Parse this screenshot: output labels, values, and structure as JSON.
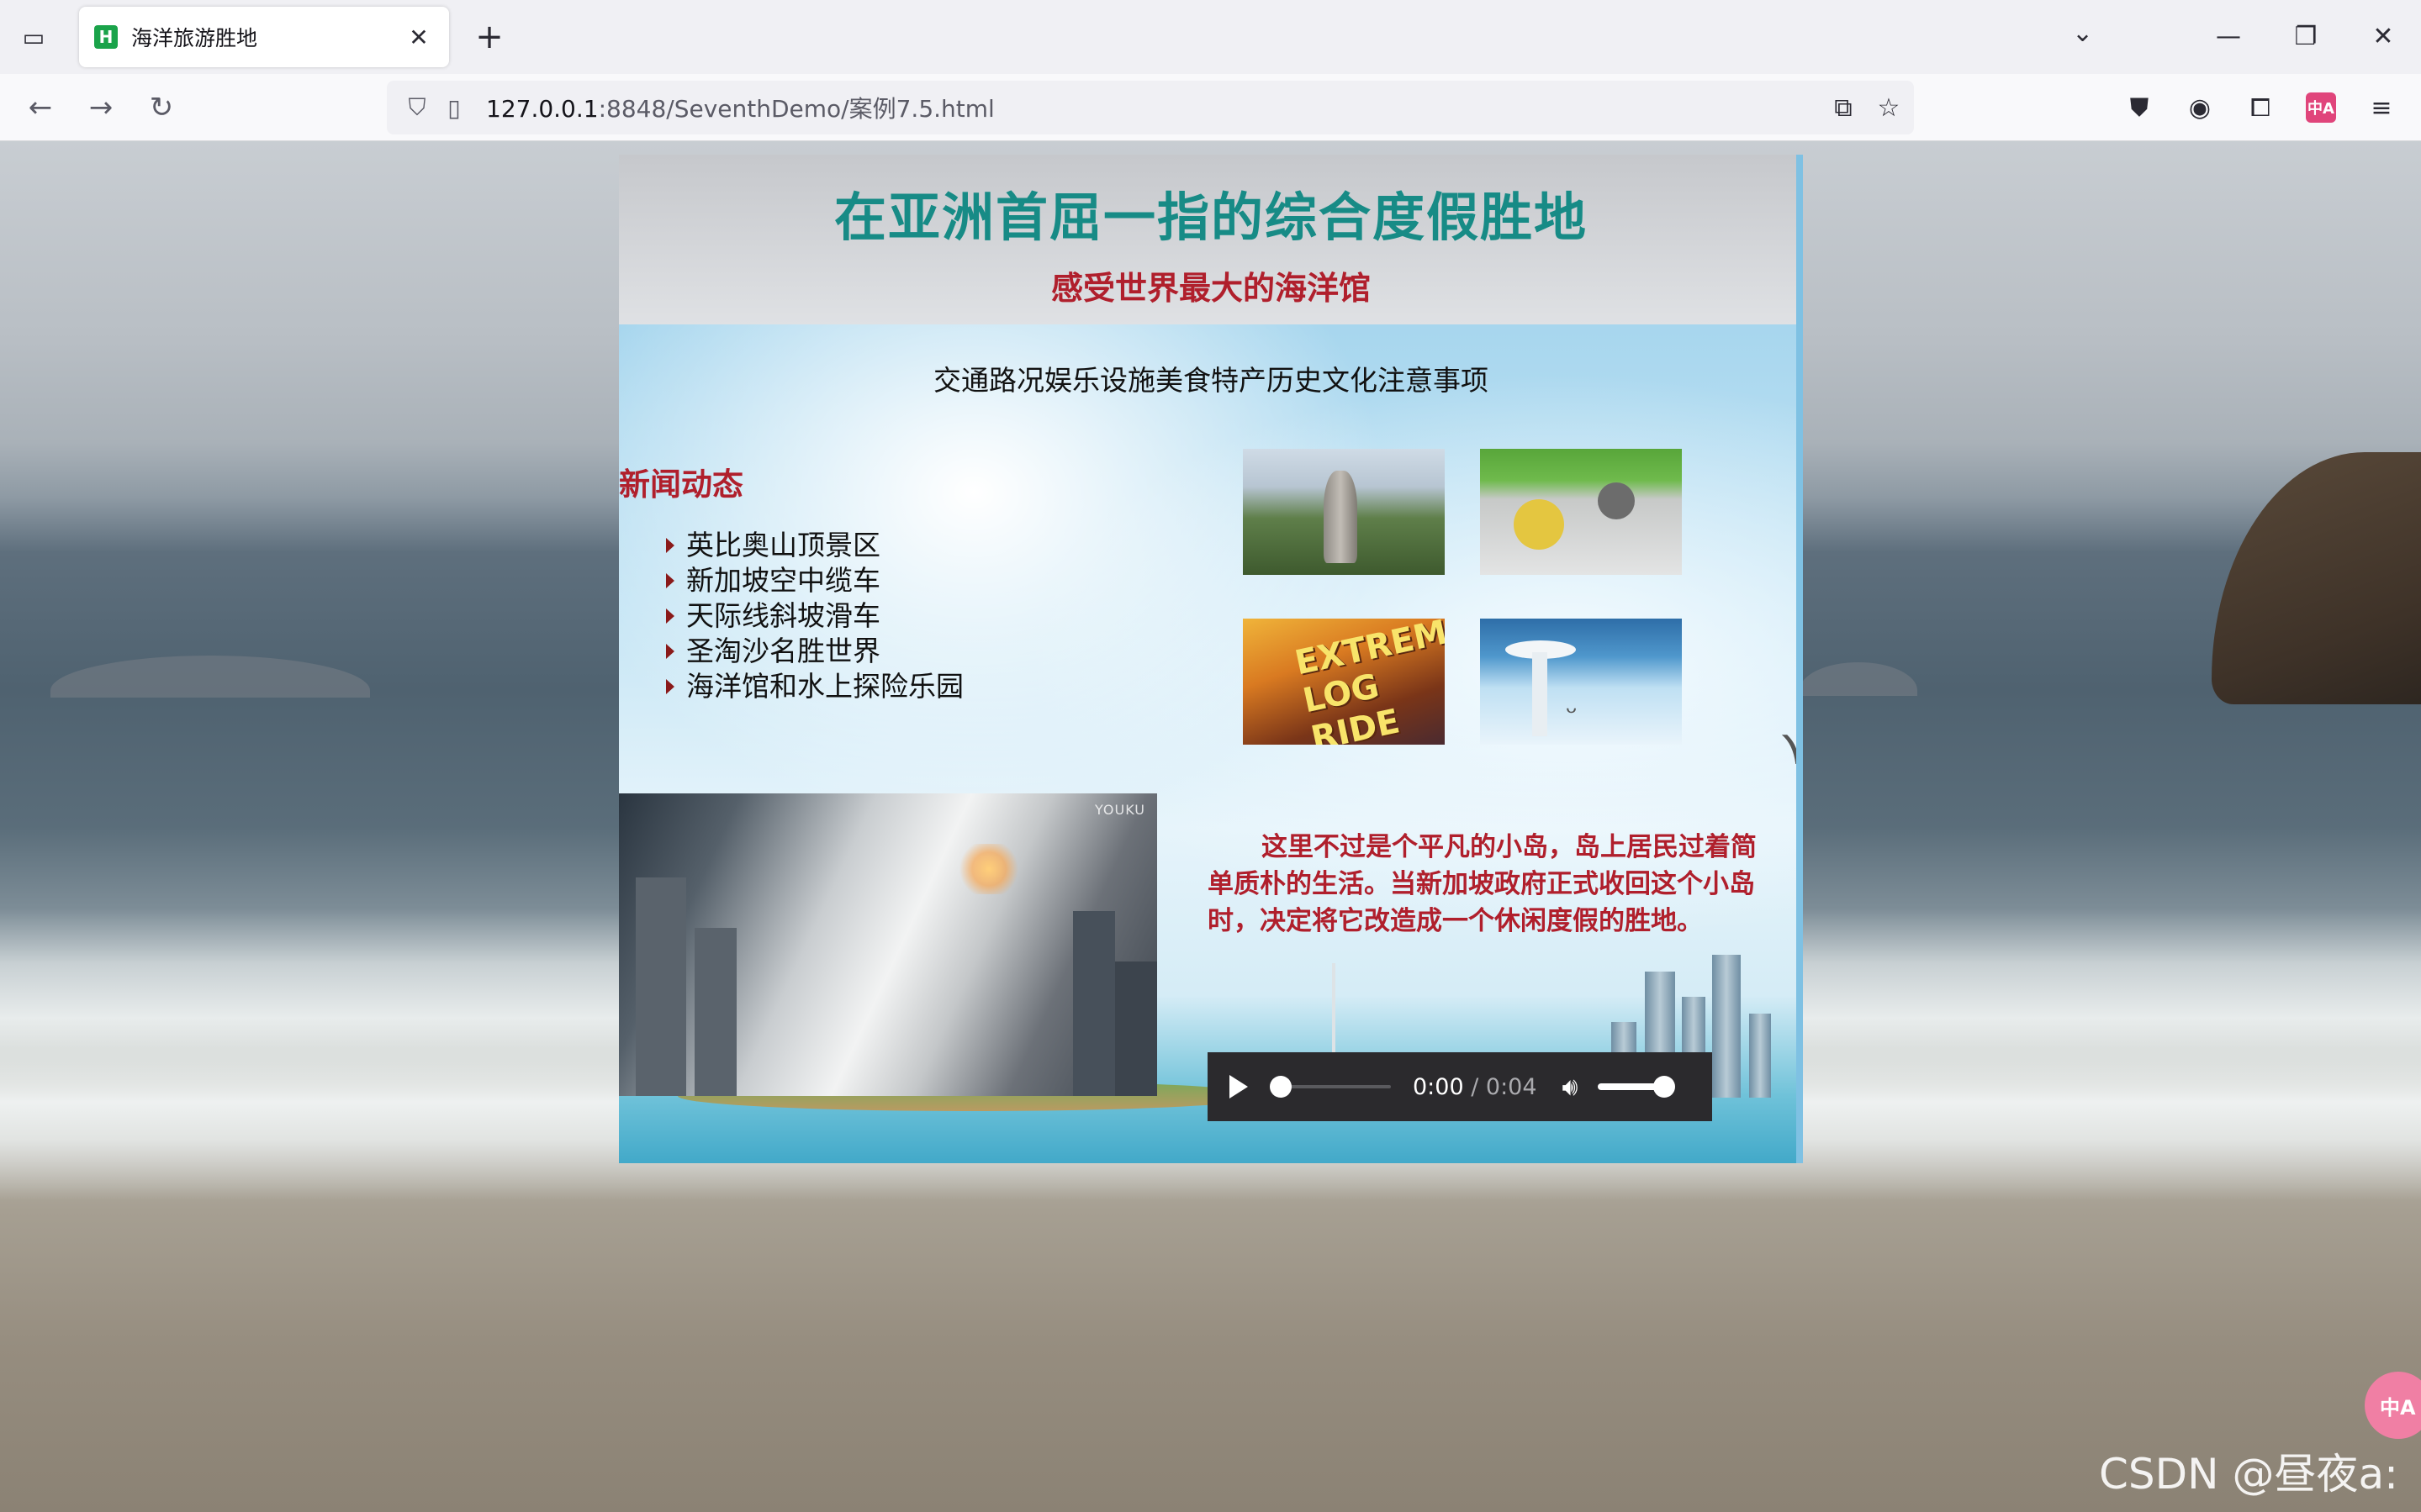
{
  "browser": {
    "tab_title": "海洋旅游胜地",
    "favicon_letter": "H",
    "url_host": "127.0.0.1",
    "url_rest": ":8848/SeventhDemo/案例7.5.html",
    "translate_badge": "中A"
  },
  "page": {
    "banner_title": "在亚洲首屈一指的综合度假胜地",
    "banner_subtitle": "感受世界最大的海洋馆",
    "nav_links": "交通路况娱乐设施美食特产历史文化注意事项",
    "news_title": "新闻动态",
    "news_items": [
      "英比奥山顶景区",
      "新加坡空中缆车",
      "天际线斜坡滑车",
      "圣淘沙名胜世界",
      "海洋馆和水上探险乐园"
    ],
    "thumb_3_sign": "EXTREME LOG RIDE",
    "video_watermark": "YOUKU",
    "description": "这里不过是个平凡的小岛，岛上居民过着简单质朴的生活。当新加坡政府正式收回这个小岛时，决定将它改造成一个休闲度假的胜地。",
    "audio": {
      "current_time": "0:00",
      "separator": " / ",
      "duration": "0:04",
      "progress": 0,
      "volume": 1.0
    }
  },
  "overlay": {
    "float_translate": "中A",
    "watermark": "CSDN @昼夜a:"
  }
}
